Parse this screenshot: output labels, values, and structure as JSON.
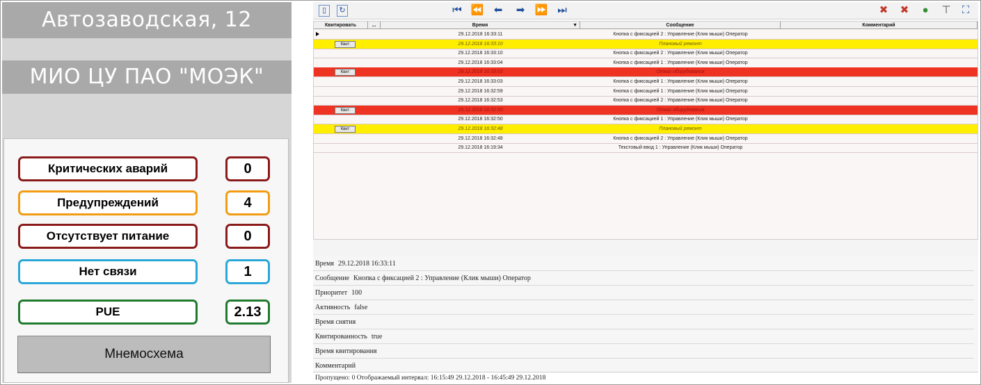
{
  "left": {
    "address": "Автозаводская, 12",
    "org": "МИО ЦУ ПАО \"МОЭК\"",
    "indicators": [
      {
        "label": "Критических аварий",
        "value": "0",
        "color": "#8b1a1a"
      },
      {
        "label": "Предупреждений",
        "value": "4",
        "color": "#f39c12"
      },
      {
        "label": "Отсутствует питание",
        "value": "0",
        "color": "#8b1a1a"
      },
      {
        "label": "Нет связи",
        "value": "1",
        "color": "#2aa7d8"
      },
      {
        "label": "PUE",
        "value": "2.13",
        "color": "#1f7a2e"
      }
    ],
    "mnemo_button": "Мнемосхема"
  },
  "toolbar": {
    "icons": [
      "panel-icon",
      "refresh-icon",
      "first-icon",
      "rewind-icon",
      "prev-icon",
      "next-icon",
      "fast-forward-icon",
      "last-icon",
      "clear-selected-icon",
      "clear-all-icon",
      "play-icon",
      "filter-icon",
      "fullscreen-icon"
    ]
  },
  "grid": {
    "columns": {
      "kvit": "Квитировать",
      "dots": "...",
      "time": "Время",
      "message": "Сообщение",
      "comment": "Комментарий"
    },
    "kvit_button": "Квит",
    "rows": [
      {
        "time": "29.12.2018 16:33:11",
        "message": "Кнопка с фиксацией 2 : Управление (Клик мыши) Оператор",
        "type": "normal",
        "kvit": false,
        "marker": true
      },
      {
        "time": "29.12.2018 16:33:10",
        "message": "Плановый ремонт",
        "type": "yellow",
        "kvit": true
      },
      {
        "time": "29.12.2018 16:33:10",
        "message": "Кнопка с фиксацией 2 : Управление (Клик мыши) Оператор",
        "type": "normal",
        "kvit": false
      },
      {
        "time": "29.12.2018 16:33:04",
        "message": "Кнопка с фиксацией 1 : Управление (Клик мыши) Оператор",
        "type": "normal",
        "kvit": false
      },
      {
        "time": "29.12.2018 16:33:03",
        "message": "Отказ оборудования",
        "type": "red",
        "kvit": true
      },
      {
        "time": "29.12.2018 16:33:03",
        "message": "Кнопка с фиксацией 1 : Управление (Клик мыши) Оператор",
        "type": "normal",
        "kvit": false
      },
      {
        "time": "29.12.2018 16:32:59",
        "message": "Кнопка с фиксацией 1 : Управление (Клик мыши) Оператор",
        "type": "normal",
        "kvit": false
      },
      {
        "time": "29.12.2018 16:32:53",
        "message": "Кнопка с фиксацией 2 : Управление (Клик мыши) Оператор",
        "type": "normal",
        "kvit": false
      },
      {
        "time": "29.12.2018 16:32:50",
        "message": "Отказ оборудования",
        "type": "red",
        "kvit": true
      },
      {
        "time": "29.12.2018 16:32:50",
        "message": "Кнопка с фиксацией 1 : Управление (Клик мыши) Оператор",
        "type": "normal",
        "kvit": false
      },
      {
        "time": "29.12.2018 16:32:48",
        "message": "Плановый ремонт",
        "type": "yellow",
        "kvit": true
      },
      {
        "time": "29.12.2018 16:32:48",
        "message": "Кнопка с фиксацией 2 : Управление (Клик мыши) Оператор",
        "type": "normal",
        "kvit": false
      },
      {
        "time": "29.12.2018 16:19:34",
        "message": "Текстовый ввод 1 : Управление (Клик мыши) Оператор",
        "type": "normal",
        "kvit": false
      }
    ]
  },
  "detail": [
    {
      "label": "Время",
      "value": "29.12.2018 16:33:11"
    },
    {
      "label": "Сообщение",
      "value": "Кнопка с фиксацией 2 : Управление (Клик мыши) Оператор"
    },
    {
      "label": "Приоритет",
      "value": "100"
    },
    {
      "label": "Активность",
      "value": "false"
    },
    {
      "label": "Время снятия",
      "value": ""
    },
    {
      "label": "Квитированность",
      "value": "true"
    },
    {
      "label": "Время квитирования",
      "value": ""
    },
    {
      "label": "Комментарий",
      "value": ""
    }
  ],
  "status": "Пропущено: 0 Отображаемый интервал: 16:15:49 29.12.2018 - 16:45:49 29.12.2018"
}
